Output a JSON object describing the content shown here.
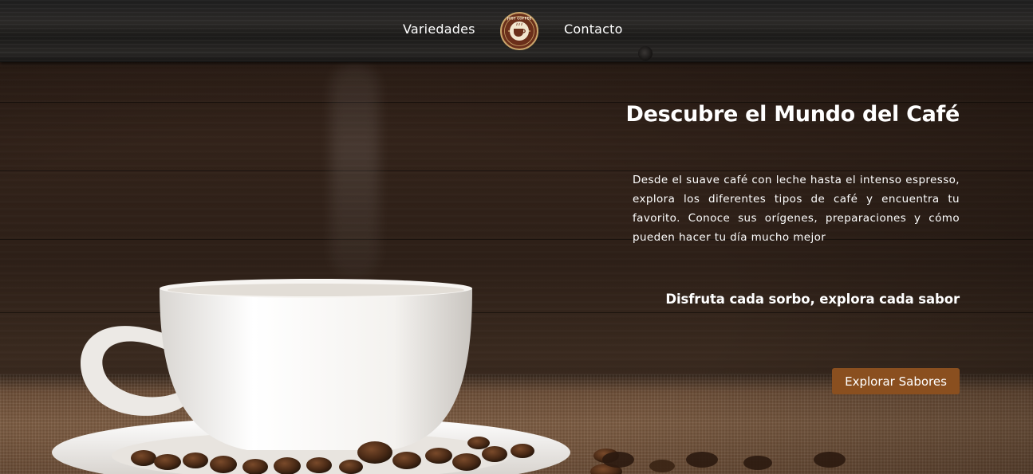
{
  "nav": {
    "links": [
      {
        "label": "Variedades"
      },
      {
        "label": "Contacto"
      }
    ],
    "logo_text": "JUST COFFEE"
  },
  "hero": {
    "title": "Descubre el Mundo del Café",
    "description": "Desde el suave café con leche hasta el intenso espresso, explora los diferentes tipos de café y encuentra tu favorito. Conoce sus orígenes, preparaciones y cómo pueden hacer tu día mucho mejor",
    "tagline": "Disfruta cada sorbo, explora cada sabor",
    "cta_label": "Explorar Sabores"
  },
  "colors": {
    "accent": "#8a4f1f",
    "logo_bg": "#6b2f1a",
    "logo_ring": "#c9a46a",
    "text": "#ffffff"
  },
  "icons": {
    "logo": "coffee-cup-emblem-icon"
  }
}
